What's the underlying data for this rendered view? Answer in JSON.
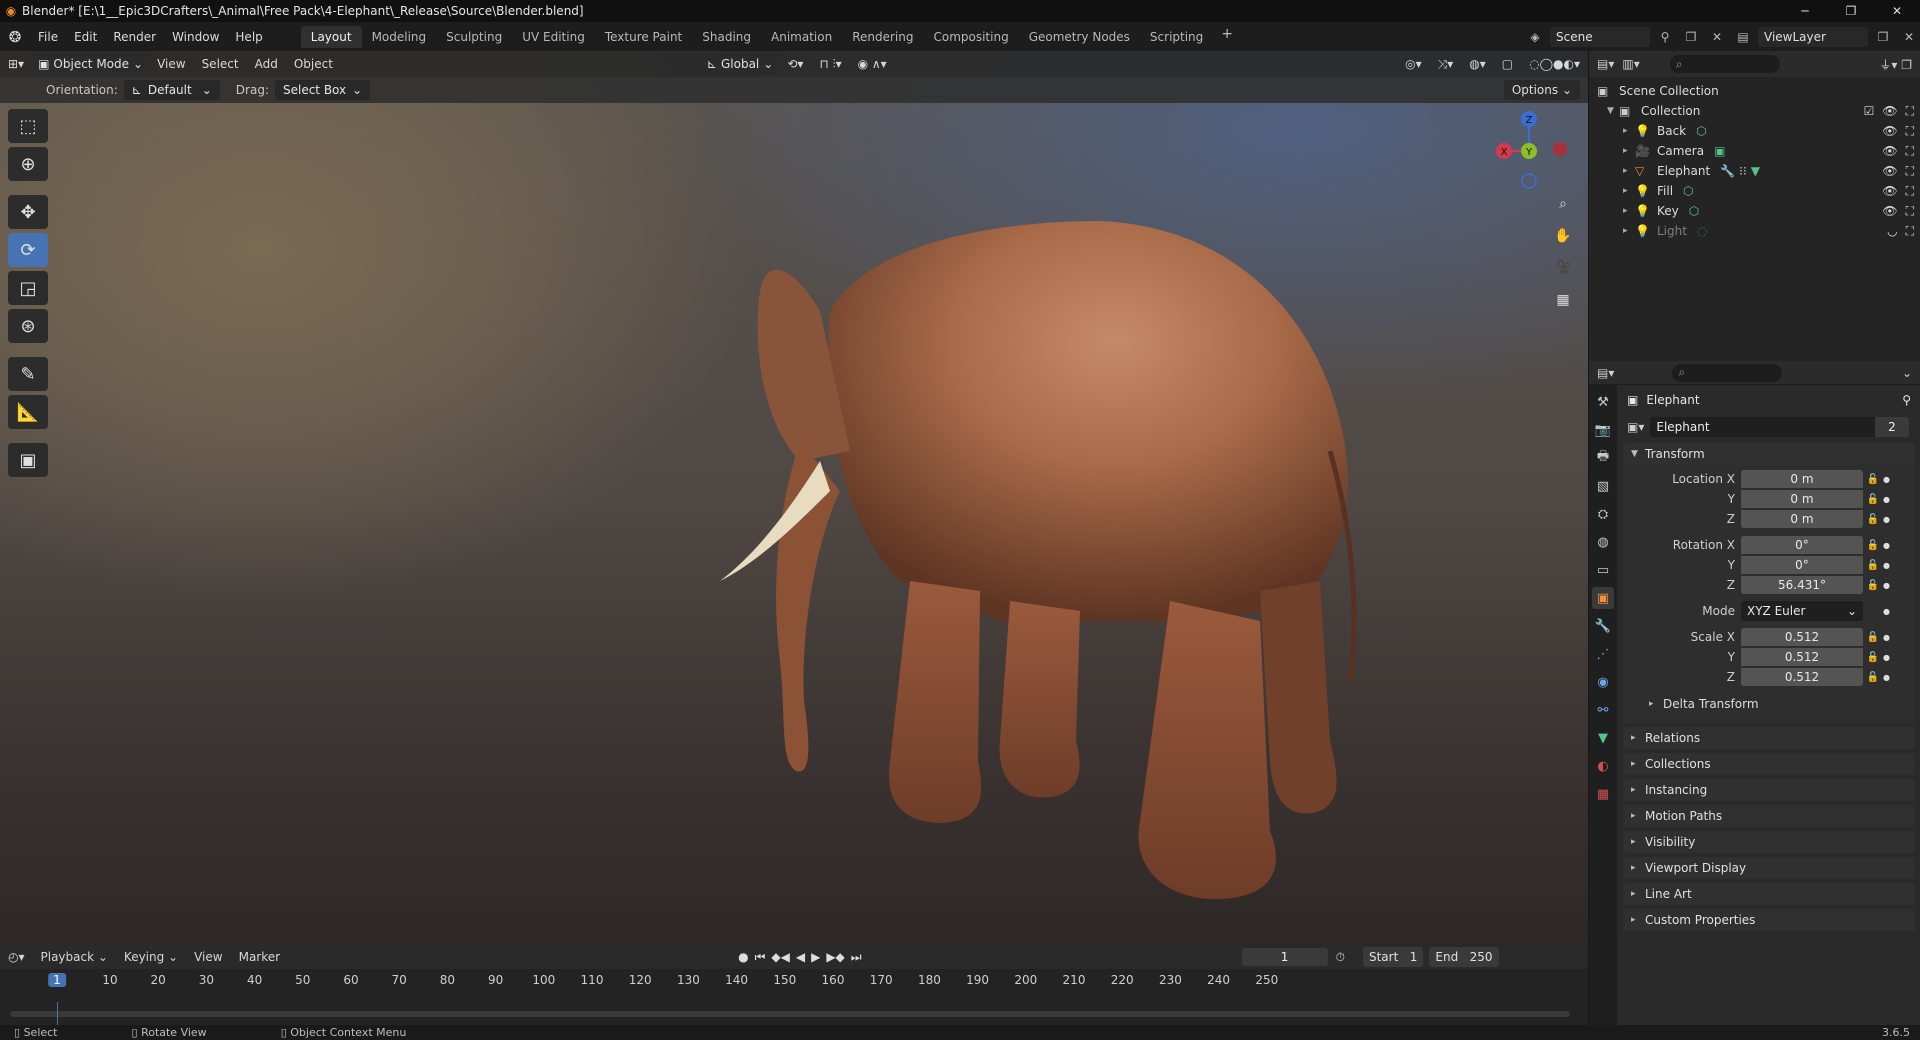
{
  "window": {
    "title": "Blender* [E:\\1__Epic3DCrafters\\_Animal\\Free Pack\\4-Elephant\\_Release\\Source\\Blender.blend]",
    "minimize": "─",
    "maximize": "❐",
    "close": "✕"
  },
  "menu": {
    "items": [
      "File",
      "Edit",
      "Render",
      "Window",
      "Help"
    ]
  },
  "workspaces": [
    "Layout",
    "Modeling",
    "Sculpting",
    "UV Editing",
    "Texture Paint",
    "Shading",
    "Animation",
    "Rendering",
    "Compositing",
    "Geometry Nodes",
    "Scripting"
  ],
  "workspace_add": "+",
  "scene": {
    "name": "Scene",
    "view_layer": "ViewLayer"
  },
  "viewport_header": {
    "mode": "Object Mode",
    "menus": [
      "View",
      "Select",
      "Add",
      "Object"
    ],
    "transform_orientation": "Global"
  },
  "tool_settings": {
    "orientation_label": "Orientation:",
    "orientation_value": "Default",
    "drag_label": "Drag:",
    "drag_value": "Select Box",
    "options": "Options"
  },
  "gizmo": {
    "x": "X",
    "y": "Y",
    "z": "Z"
  },
  "outliner": {
    "scene_collection": "Scene Collection",
    "collection": "Collection",
    "objects": [
      {
        "name": "Back"
      },
      {
        "name": "Camera"
      },
      {
        "name": "Elephant"
      },
      {
        "name": "Fill"
      },
      {
        "name": "Key"
      },
      {
        "name": "Light"
      }
    ]
  },
  "properties": {
    "object_name": "Elephant",
    "data_name": "Elephant",
    "users": "2",
    "transform_title": "Transform",
    "location": {
      "label": "Location X",
      "x": "0 m",
      "y": "0 m",
      "z": "0 m"
    },
    "rotation": {
      "label": "Rotation X",
      "x": "0°",
      "y": "0°",
      "z": "56.431°"
    },
    "mode_label": "Mode",
    "mode_value": "XYZ Euler",
    "scale": {
      "label": "Scale X",
      "x": "0.512",
      "y": "0.512",
      "z": "0.512"
    },
    "axis_y": "Y",
    "axis_z": "Z",
    "delta_transform": "Delta Transform",
    "panels": [
      "Relations",
      "Collections",
      "Instancing",
      "Motion Paths",
      "Visibility",
      "Viewport Display",
      "Line Art",
      "Custom Properties"
    ]
  },
  "timeline": {
    "menus": [
      "Playback",
      "Keying",
      "View",
      "Marker"
    ],
    "current_frame": "1",
    "start_label": "Start",
    "start_value": "1",
    "end_label": "End",
    "end_value": "250",
    "ticks": [
      "1",
      "10",
      "20",
      "30",
      "40",
      "50",
      "60",
      "70",
      "80",
      "90",
      "100",
      "110",
      "120",
      "130",
      "140",
      "150",
      "160",
      "170",
      "180",
      "190",
      "200",
      "210",
      "220",
      "230",
      "240",
      "250"
    ]
  },
  "status": {
    "select": "Select",
    "rotate": "Rotate View",
    "context": "Object Context Menu",
    "version": "3.6.5"
  }
}
